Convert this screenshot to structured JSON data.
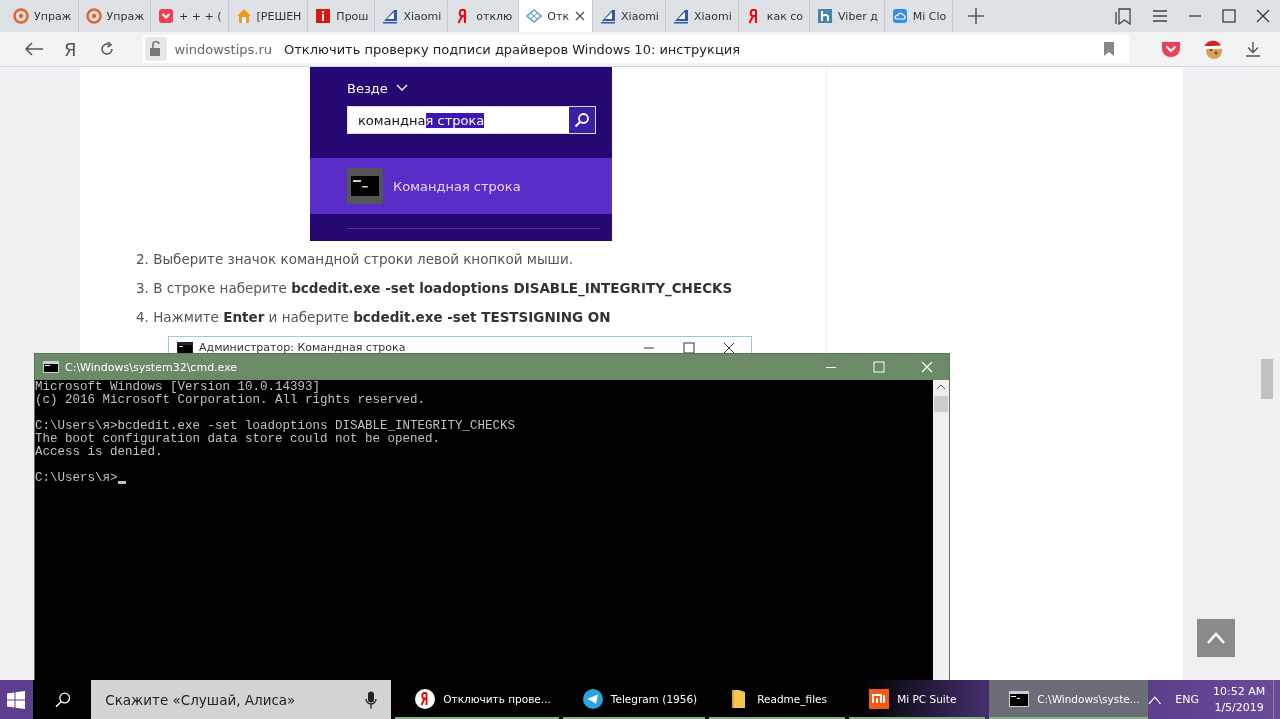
{
  "tabs": [
    {
      "label": "Упраж",
      "kind": "ring",
      "selected": false
    },
    {
      "label": "Упраж",
      "kind": "ring",
      "selected": false
    },
    {
      "label": "+ + + (",
      "kind": "pocket",
      "selected": false
    },
    {
      "label": "[РЕШЕН",
      "kind": "house",
      "selected": false
    },
    {
      "label": "Прош",
      "kind": "info",
      "selected": false
    },
    {
      "label": "Xiaomi",
      "kind": "stripes",
      "selected": false
    },
    {
      "label": "отклю",
      "kind": "ya",
      "selected": false
    },
    {
      "label": "Отк",
      "kind": "diamond",
      "selected": true
    },
    {
      "label": "Xiaomi",
      "kind": "stripes",
      "selected": false
    },
    {
      "label": "Xiaomi",
      "kind": "stripes",
      "selected": false
    },
    {
      "label": "как со",
      "kind": "ya",
      "selected": false
    },
    {
      "label": "Viber д",
      "kind": "hbox",
      "selected": false
    },
    {
      "label": "Mi Clo",
      "kind": "cloud",
      "selected": false
    }
  ],
  "address_bar": {
    "home_button": "Я",
    "domain": "windowstips.ru",
    "page_title": "Отключить проверку подписи драйверов Windows 10: инструкция"
  },
  "article": {
    "search_screenshot": {
      "scope": "Везде",
      "query_parts": [
        {
          "text": "командна",
          "selected": false
        },
        {
          "text": "я строка",
          "selected": true
        }
      ],
      "result": "Командная строка"
    },
    "steps": [
      "2. Выберите значок командной строки левой кнопкой мыши.",
      "3. В строке наберите **bcdedit.exe -set loadoptions DISABLE_INTEGRITY_CHECKS**",
      "4. Нажмите **Enter** и наберите **bcdedit.exe -set TESTSIGNING ON**"
    ],
    "embedded_window_title": "Администратор: Командная строка"
  },
  "cmd_window": {
    "title": "C:\\Windows\\system32\\cmd.exe",
    "blocks": [
      [
        "Microsoft Windows [Version 10.0.14393]",
        "(c) 2016 Microsoft Corporation. All rights reserved."
      ],
      [
        "C:\\Users\\я>bcdedit.exe -set loadoptions DISABLE_INTEGRITY_CHECKS",
        "The boot configuration data store could not be opened.",
        "Access is denied."
      ],
      [
        "C:\\Users\\я>"
      ]
    ]
  },
  "taskbar": {
    "search_placeholder": "Скажите «Слушай, Алиса»",
    "items": [
      {
        "label": "Отключить прове...",
        "kind": "yandex",
        "selected": false
      },
      {
        "label": "Telegram (1956)",
        "kind": "telegram",
        "selected": false
      },
      {
        "label": "Readme_files",
        "kind": "folder",
        "selected": false
      },
      {
        "label": "Mi PC Suite",
        "kind": "mi",
        "selected": false
      },
      {
        "label": "C:\\Windows\\syste...",
        "kind": "cmd",
        "selected": true
      }
    ],
    "language": "ENG",
    "time": "10:52 AM",
    "date": "1/5/2019"
  }
}
